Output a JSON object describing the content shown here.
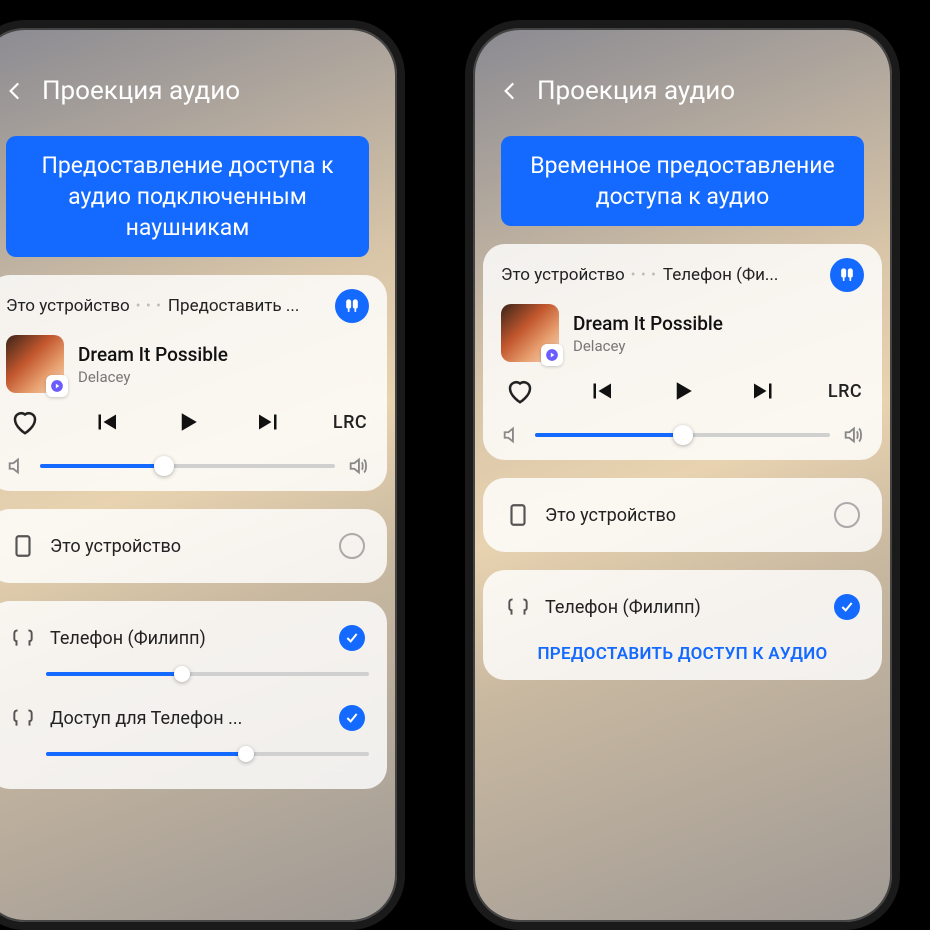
{
  "colors": {
    "accent": "#146aff"
  },
  "left": {
    "header": {
      "title": "Проекция аудио"
    },
    "callout": "Предоставление доступа к аудио подключенным наушникам",
    "breadcrumb": {
      "a": "Это устройство",
      "b": "Предоставить ..."
    },
    "track": {
      "title": "Dream It Possible",
      "artist": "Delacey"
    },
    "controls": {
      "lrc": "LRC"
    },
    "volume": {
      "percent": 42
    },
    "devices": {
      "this": {
        "label": "Это устройство"
      },
      "d1": {
        "label": "Телефон (Филипп)",
        "vol": 42
      },
      "d2": {
        "label": "Доступ для Телефон ...",
        "vol": 62
      }
    }
  },
  "right": {
    "header": {
      "title": "Проекция аудио"
    },
    "callout": "Временное предоставление доступа к аудио",
    "breadcrumb": {
      "a": "Это устройство",
      "b": "Телефон (Фи..."
    },
    "track": {
      "title": "Dream It Possible",
      "artist": "Delacey"
    },
    "controls": {
      "lrc": "LRC"
    },
    "volume": {
      "percent": 50
    },
    "devices": {
      "this": {
        "label": "Это устройство"
      },
      "d1": {
        "label": "Телефон (Филипп)"
      }
    },
    "cta": "ПРЕДОСТАВИТЬ ДОСТУП К АУДИО"
  }
}
